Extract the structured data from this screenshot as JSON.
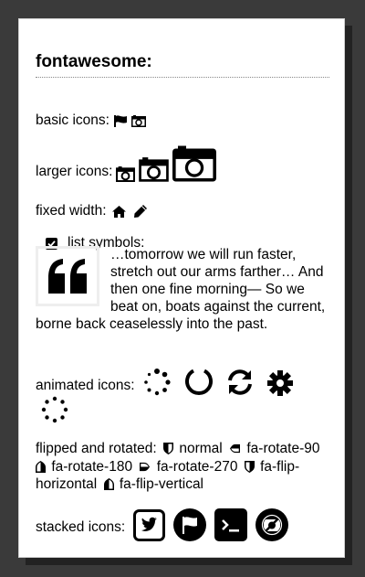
{
  "page": {
    "title": "fontawesome:"
  },
  "basic": {
    "label": "basic icons:",
    "icons": [
      "flag-icon",
      "camera-retro-icon"
    ]
  },
  "larger": {
    "label": "larger icons:",
    "icons": [
      "camera-retro-icon-lg",
      "camera-retro-icon-2x",
      "camera-retro-icon-3x"
    ]
  },
  "fixed": {
    "label": "fixed width:",
    "icons": [
      "home-icon",
      "pencil-icon"
    ]
  },
  "list": {
    "label": "list symbols:",
    "checked": true
  },
  "quote": {
    "text": "…tomorrow we will run faster, stretch out our arms farther… And then one fine morning— So we beat on, boats against the current, borne back ceaselessly into the past.",
    "icon": "quote-left-icon"
  },
  "animated": {
    "label": "animated icons:",
    "icons": [
      "spinner-icon",
      "circle-notch-icon",
      "refresh-icon",
      "cog-icon",
      "spinner-pulse-icon"
    ]
  },
  "rotated": {
    "label": "flipped and rotated:",
    "items": [
      {
        "label": "normal"
      },
      {
        "label": "fa-rotate-90"
      },
      {
        "label": "fa-rotate-180"
      },
      {
        "label": "fa-rotate-270"
      },
      {
        "label": "fa-flip-horizontal"
      },
      {
        "label": "fa-flip-vertical"
      }
    ]
  },
  "stacked": {
    "label": "stacked icons:",
    "icons": [
      "twitter-square-icon",
      "flag-circle-icon",
      "terminal-square-icon",
      "ban-camera-icon"
    ]
  }
}
